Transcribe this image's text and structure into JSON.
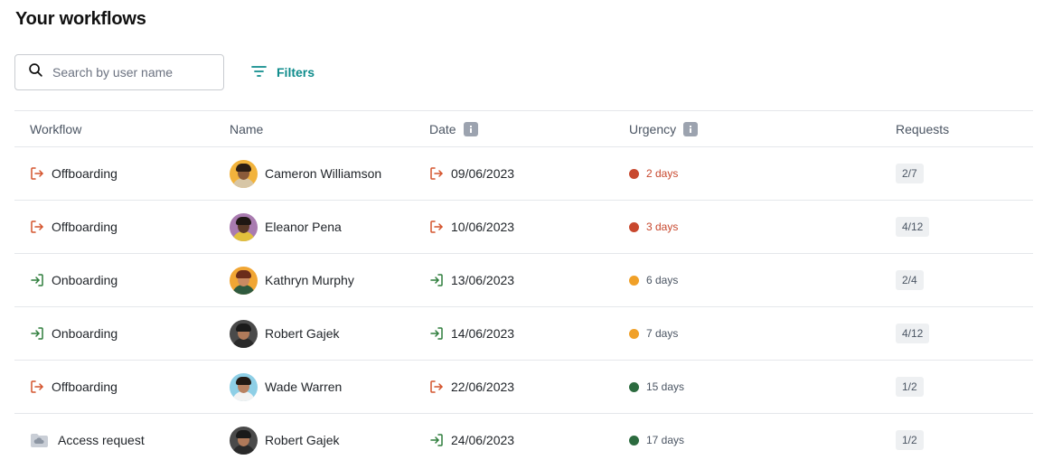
{
  "page": {
    "title": "Your workflows"
  },
  "search": {
    "placeholder": "Search by user name",
    "value": ""
  },
  "filters": {
    "label": "Filters"
  },
  "colors": {
    "accent": "#0f8c8c",
    "offboarding": "#d4532c",
    "onboarding": "#2e7d3b",
    "urgent": "#c8482e",
    "warning": "#f0a028",
    "ok": "#2c6b3f"
  },
  "table": {
    "headers": {
      "workflow": "Workflow",
      "name": "Name",
      "date": "Date",
      "urgency": "Urgency",
      "requests": "Requests"
    },
    "rows": [
      {
        "workflow": "Offboarding",
        "workflow_icon": "exit-icon",
        "name": "Cameron Williamson",
        "avatar": "avatar-cameron",
        "date": "09/06/2023",
        "date_icon": "exit-icon",
        "urgency": "2 days",
        "urgency_level": "urgent",
        "requests": "2/7"
      },
      {
        "workflow": "Offboarding",
        "workflow_icon": "exit-icon",
        "name": "Eleanor Pena",
        "avatar": "avatar-eleanor",
        "date": "10/06/2023",
        "date_icon": "exit-icon",
        "urgency": "3 days",
        "urgency_level": "urgent",
        "requests": "4/12"
      },
      {
        "workflow": "Onboarding",
        "workflow_icon": "enter-icon",
        "name": "Kathryn Murphy",
        "avatar": "avatar-kathryn",
        "date": "13/06/2023",
        "date_icon": "enter-icon",
        "urgency": "6 days",
        "urgency_level": "warning",
        "requests": "2/4"
      },
      {
        "workflow": "Onboarding",
        "workflow_icon": "enter-icon",
        "name": "Robert Gajek",
        "avatar": "avatar-robert",
        "date": "14/06/2023",
        "date_icon": "enter-icon",
        "urgency": "7 days",
        "urgency_level": "warning",
        "requests": "4/12"
      },
      {
        "workflow": "Offboarding",
        "workflow_icon": "exit-icon",
        "name": "Wade Warren",
        "avatar": "avatar-wade",
        "date": "22/06/2023",
        "date_icon": "exit-icon",
        "urgency": "15 days",
        "urgency_level": "ok",
        "requests": "1/2"
      },
      {
        "workflow": "Access request",
        "workflow_icon": "folder-cloud-icon",
        "name": "Robert Gajek",
        "avatar": "avatar-robert",
        "date": "24/06/2023",
        "date_icon": "enter-icon",
        "urgency": "17 days",
        "urgency_level": "ok",
        "requests": "1/2"
      }
    ]
  }
}
